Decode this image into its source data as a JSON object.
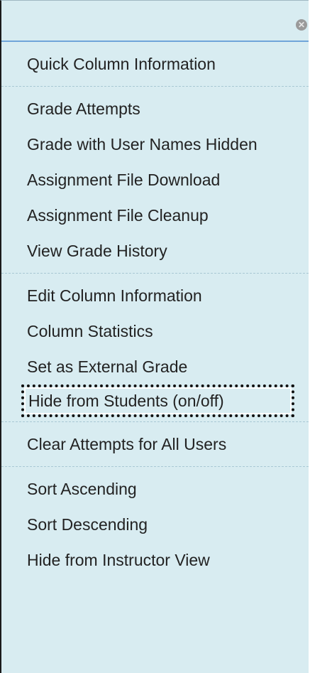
{
  "menu": {
    "close_icon": "close-icon",
    "groups": [
      {
        "items": [
          {
            "label": "Quick Column Information"
          }
        ]
      },
      {
        "items": [
          {
            "label": "Grade Attempts"
          },
          {
            "label": "Grade with User Names Hidden"
          },
          {
            "label": "Assignment File Download"
          },
          {
            "label": "Assignment File Cleanup"
          },
          {
            "label": "View Grade History"
          }
        ]
      },
      {
        "items": [
          {
            "label": "Edit Column Information"
          },
          {
            "label": "Column Statistics"
          },
          {
            "label": "Set as External Grade"
          },
          {
            "label": "Hide from Students (on/off)",
            "focused": true
          }
        ]
      },
      {
        "items": [
          {
            "label": "Clear Attempts for All Users"
          }
        ]
      },
      {
        "items": [
          {
            "label": "Sort Ascending"
          },
          {
            "label": "Sort Descending"
          },
          {
            "label": "Hide from Instructor View"
          }
        ]
      }
    ]
  },
  "colors": {
    "background": "#d8ecf1",
    "header_border": "#6fa5d9",
    "divider": "#a9c8d4",
    "text": "#222222"
  }
}
